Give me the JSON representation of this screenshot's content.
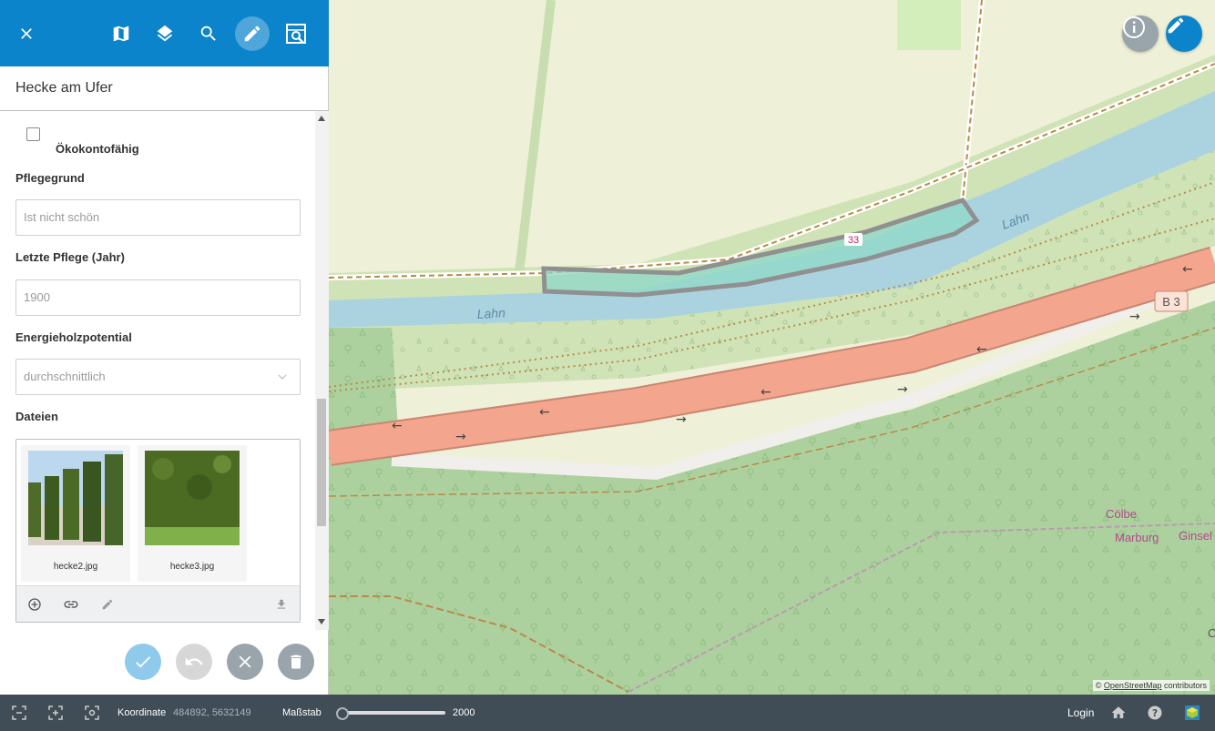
{
  "panel": {
    "title": "Hecke am Ufer",
    "toolbar": [
      "close-icon",
      "map-icon",
      "layers-icon",
      "search-icon",
      "edit-icon",
      "map-search-icon"
    ]
  },
  "form": {
    "checkbox_label": "Ökokontofähig",
    "checkbox_checked": false,
    "pflegegrund": {
      "label": "Pflegegrund",
      "placeholder": "Ist nicht schön"
    },
    "letzte_pflege": {
      "label": "Letzte Pflege (Jahr)",
      "placeholder": "1900"
    },
    "energie": {
      "label": "Energieholzpotential",
      "value": "durchschnittlich"
    },
    "dateien": {
      "label": "Dateien",
      "files": [
        {
          "name": "hecke2.jpg"
        },
        {
          "name": "hecke3.jpg"
        }
      ]
    }
  },
  "actions": [
    "confirm-icon",
    "undo-icon",
    "cancel-icon",
    "delete-icon"
  ],
  "map": {
    "labels": {
      "river1": "Lahn",
      "river2": "Lahn",
      "road_shield": "B 3",
      "feature_id": "33",
      "place1": "Cölbe",
      "place2": "Marburg",
      "place3": "Ginsel",
      "place4": "C"
    },
    "attribution_prefix": "©",
    "attribution_link": "OpenStreetMap",
    "attribution_suffix": " contributors"
  },
  "statusbar": {
    "koordinate_label": "Koordinate",
    "koordinate_value": "484892, 5632149",
    "massstab_label": "Maßstab",
    "massstab_value": "2000",
    "login": "Login"
  },
  "colors": {
    "primary": "#0b84cc",
    "statusbar": "#414d56",
    "road": "#f4a58d",
    "water": "#aad3df",
    "forest": "#add19e",
    "feature_fill": "#8fd8c8"
  }
}
